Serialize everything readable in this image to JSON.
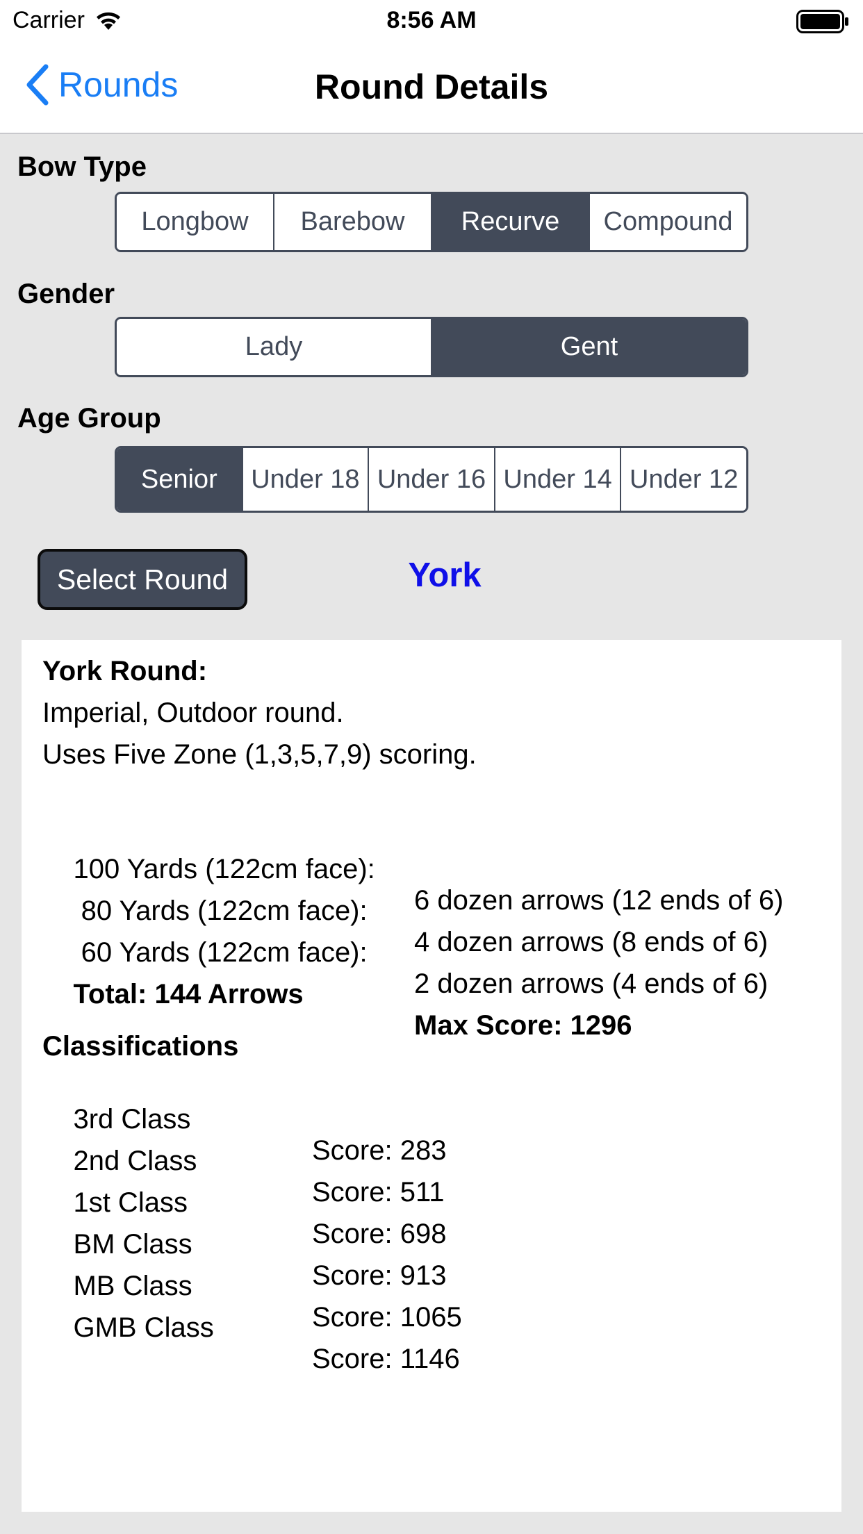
{
  "status_bar": {
    "carrier": "Carrier",
    "time": "8:56 AM"
  },
  "nav": {
    "back_label": "Rounds",
    "title": "Round Details"
  },
  "bow_type": {
    "label": "Bow Type",
    "options": [
      "Longbow",
      "Barebow",
      "Recurve",
      "Compound"
    ],
    "selected": "Recurve"
  },
  "gender": {
    "label": "Gender",
    "options": [
      "Lady",
      "Gent"
    ],
    "selected": "Gent"
  },
  "age_group": {
    "label": "Age Group",
    "options": [
      "Senior",
      "Under 18",
      "Under 16",
      "Under 14",
      "Under 12"
    ],
    "selected": "Senior"
  },
  "round_select": {
    "button_label": "Select Round",
    "selected_round": "York"
  },
  "details": {
    "heading": "York Round:",
    "description_1": "Imperial, Outdoor round.",
    "description_2": "Uses Five Zone (1,3,5,7,9) scoring.",
    "distances": [
      {
        "distance": "100 Yards (122cm face):",
        "arrows": "6 dozen arrows (12 ends of 6)"
      },
      {
        "distance": " 80 Yards (122cm face):",
        "arrows": "4 dozen arrows (8 ends of 6)"
      },
      {
        "distance": " 60 Yards (122cm face):",
        "arrows": "2 dozen arrows (4 ends of 6)"
      }
    ],
    "total_arrows": "Total: 144 Arrows",
    "max_score": "Max Score: 1296",
    "classifications_heading": "Classifications",
    "classifications": [
      {
        "name": "3rd Class",
        "score": "Score: 283"
      },
      {
        "name": "2nd Class",
        "score": "Score: 511"
      },
      {
        "name": "1st Class",
        "score": "Score: 698"
      },
      {
        "name": "BM Class",
        "score": "Score: 913"
      },
      {
        "name": "MB Class",
        "score": "Score: 1065"
      },
      {
        "name": "GMB Class",
        "score": "Score: 1146"
      }
    ]
  },
  "colors": {
    "accent_blue": "#1a7ef5",
    "segment_dark": "#424a59",
    "round_name": "#0f0fe8",
    "background": "#e6e6e6"
  }
}
